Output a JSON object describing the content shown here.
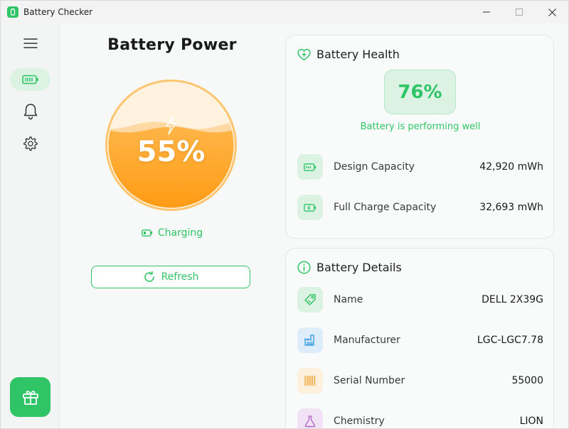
{
  "app": {
    "title": "Battery Checker"
  },
  "main": {
    "title": "Battery Power",
    "percent": "55%",
    "charge_level": 0.55,
    "status": "Charging",
    "refresh_label": "Refresh"
  },
  "health": {
    "title": "Battery Health",
    "percent": "76%",
    "message": "Battery is performing well",
    "rows": [
      {
        "label": "Design Capacity",
        "value": "42,920 mWh"
      },
      {
        "label": "Full Charge Capacity",
        "value": "32,693 mWh"
      }
    ]
  },
  "details": {
    "title": "Battery Details",
    "rows": [
      {
        "label": "Name",
        "value": "DELL 2X39G"
      },
      {
        "label": "Manufacturer",
        "value": "LGC-LGC7.78"
      },
      {
        "label": "Serial Number",
        "value": "55000"
      },
      {
        "label": "Chemistry",
        "value": "LION"
      }
    ]
  },
  "colors": {
    "accent": "#2fc566",
    "battery_orange": "#ff9f1c",
    "battery_light": "#ffd59a"
  },
  "icons": {
    "menu": "hamburger-icon",
    "battery": "battery-icon",
    "notifications": "bell-icon",
    "settings": "gear-icon",
    "gift": "gift-icon"
  }
}
